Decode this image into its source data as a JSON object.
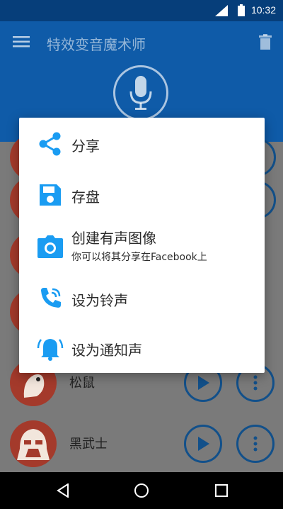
{
  "status": {
    "time": "10:32"
  },
  "toolbar": {
    "title": "特效变音魔术师"
  },
  "list": {
    "rows": [
      {
        "title": "松鼠"
      },
      {
        "title": "黑武士"
      }
    ]
  },
  "dialog": {
    "items": [
      {
        "label": "分享",
        "icon": "share-icon"
      },
      {
        "label": "存盘",
        "icon": "save-icon"
      },
      {
        "label": "创建有声图像",
        "sub": "你可以将其分享在Facebook上",
        "icon": "camera-icon"
      },
      {
        "label": "设为铃声",
        "icon": "ringtone-icon"
      },
      {
        "label": "设为通知声",
        "icon": "notification-bell-icon"
      }
    ]
  },
  "colors": {
    "primary": "#0f5ba8",
    "primary_dark": "#063e7a",
    "accent": "#1a9cf2",
    "avatar": "#a43a2b"
  }
}
